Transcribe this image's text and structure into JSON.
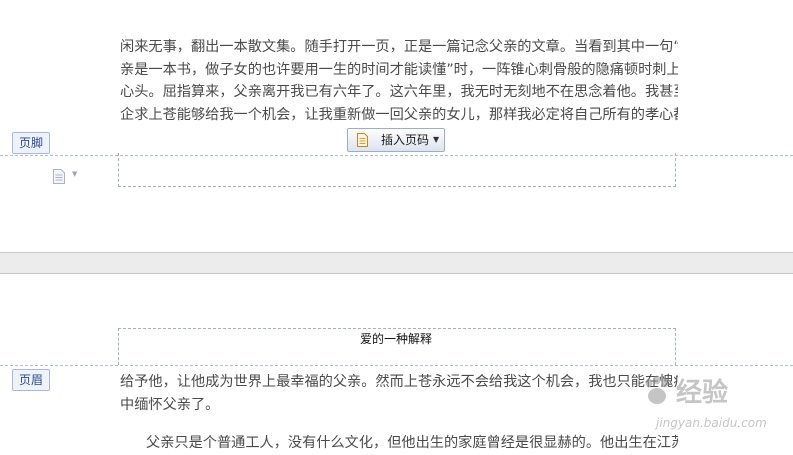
{
  "page1": {
    "body_lines": [
      "闲来无事，翻出一本散文集。随手打开一页，正是一篇记念父亲的文章。当看到其中一句“父",
      "亲是一本书，做子女的也许要用一生的时间才能读懂”时，一阵锥心刺骨般的隐痛顿时刺上",
      "心头。屈指算来，父亲离开我已有六年了。这六年里，我无时无刻地不在思念着他。我甚至",
      "企求上苍能够给我一个机会，让我重新做一回父亲的女儿，那样我必定将自己所有的孝心都"
    ],
    "footer_tag": "页脚",
    "insert_page_number_label": "插入页码"
  },
  "page2": {
    "header_title": "爱的一种解释",
    "header_tag": "页眉",
    "body_lines": [
      "给予他，让他成为世界上最幸福的父亲。然而上苍永远不会给我这个机会，我也只能在愧疚",
      "中缅怀父亲了。"
    ],
    "partial_line": "父亲只是个普通工人，没有什么文化，但他出生的家庭曾经是很显赫的。他出生在江苏"
  },
  "watermark": {
    "name": "经验",
    "url": "jingyan.baidu.com"
  }
}
